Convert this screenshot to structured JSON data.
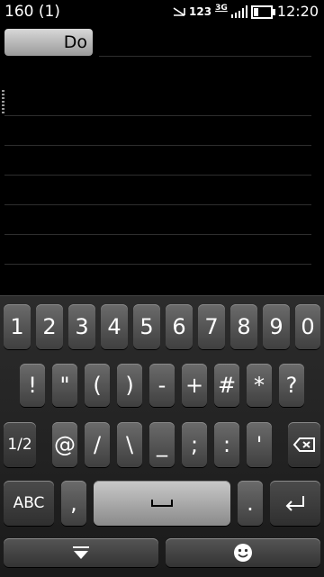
{
  "status": {
    "counter": "160 (1)",
    "network": "123",
    "network_type": "3G",
    "time": "12:20"
  },
  "toolbar": {
    "do_label": "Do"
  },
  "keyboard": {
    "row_numbers": [
      "1",
      "2",
      "3",
      "4",
      "5",
      "6",
      "7",
      "8",
      "9",
      "0"
    ],
    "row_symbols1": [
      "!",
      "\"",
      "(",
      ")",
      "-",
      "+",
      "#",
      "*",
      "?"
    ],
    "row_symbols2": [
      "@",
      "/",
      "\\",
      "_",
      ";",
      ":",
      "'"
    ],
    "page_label": "1/2",
    "abc_label": "ABC",
    "comma": ",",
    "period": ".",
    "icons": {
      "backspace": "backspace-icon",
      "space": "space-icon",
      "enter": "enter-icon",
      "hide": "hide-keyboard-icon",
      "emoji": "smiley-icon"
    }
  }
}
